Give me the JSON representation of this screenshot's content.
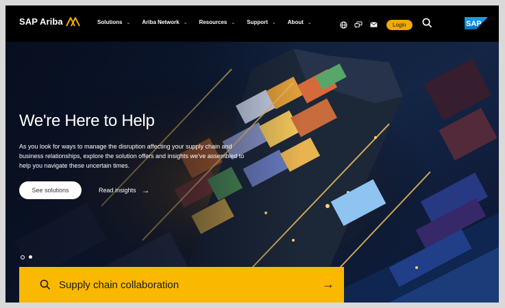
{
  "brand": {
    "name": "SAP Ariba"
  },
  "nav": {
    "menu": [
      {
        "label": "Solutions"
      },
      {
        "label": "Ariba Network"
      },
      {
        "label": "Resources"
      },
      {
        "label": "Support"
      },
      {
        "label": "About"
      }
    ],
    "icons": [
      "globe-icon",
      "chat-icon",
      "mail-icon",
      "search-icon"
    ],
    "login_label": "Login",
    "sap_logo": "SAP"
  },
  "hero": {
    "title": "We're Here to Help",
    "description": "As you look for ways to manage the disruption affecting your supply chain and business relationships, explore the solution offers and insights we've assembled to help you navigate these uncertain times.",
    "primary_button": "See solutions",
    "secondary_link": "Read insights",
    "secondary_icon": "arrow-right-icon",
    "carousel": {
      "slides": 2,
      "active": 1
    }
  },
  "search_bar": {
    "label": "Supply chain collaboration",
    "icon": "search-icon",
    "arrow_icon": "arrow-right-icon"
  },
  "colors": {
    "nav_bg": "#000000",
    "accent": "#f0ab00",
    "search_bar": "#fbb800",
    "sap_blue": "#0b8ed8"
  }
}
